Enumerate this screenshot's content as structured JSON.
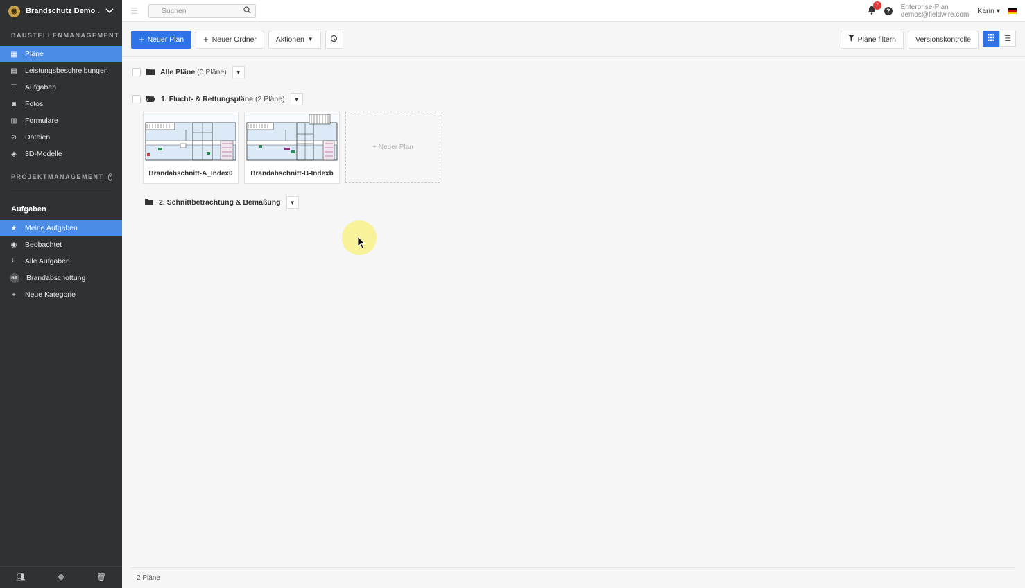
{
  "sidebar": {
    "project_name": "Brandschutz Demo ...",
    "section_baustelle": "BAUSTELLENMANAGEMENT",
    "nav_items": [
      {
        "label": "Pläne",
        "icon": "plans-icon",
        "active": true
      },
      {
        "label": "Leistungsbeschreibungen",
        "icon": "specs-icon"
      },
      {
        "label": "Aufgaben",
        "icon": "list-icon"
      },
      {
        "label": "Fotos",
        "icon": "camera-icon"
      },
      {
        "label": "Formulare",
        "icon": "clipboard-icon"
      },
      {
        "label": "Dateien",
        "icon": "paperclip-icon"
      },
      {
        "label": "3D-Modelle",
        "icon": "cube-icon"
      }
    ],
    "section_projekt": "PROJEKTMANAGEMENT",
    "tasks_group": "Aufgaben",
    "task_items": [
      {
        "label": "Meine Aufgaben",
        "icon": "star-icon",
        "active": true
      },
      {
        "label": "Beobachtet",
        "icon": "eye-icon"
      },
      {
        "label": "Alle Aufgaben",
        "icon": "grid-icon"
      },
      {
        "label": "Brandabschottung",
        "icon": "category-badge",
        "badge": "BR"
      },
      {
        "label": "Neue Kategorie",
        "icon": "plus-icon"
      }
    ]
  },
  "topbar": {
    "search_placeholder": "Suchen",
    "notification_count": "7",
    "plan_name": "Enterprise-Plan",
    "plan_email": "demos@fieldwire.com",
    "user": "Karin"
  },
  "toolbar": {
    "new_plan": "Neuer Plan",
    "new_folder": "Neuer Ordner",
    "actions": "Aktionen",
    "filter": "Pläne filtern",
    "version_control": "Versionskontrolle"
  },
  "folders": [
    {
      "name": "Alle Pläne",
      "count": "(0 Pläne)"
    },
    {
      "name": "1. Flucht- & Rettungspläne",
      "count": "(2 Pläne)"
    },
    {
      "name": "2. Schnittbetrachtung & Bemaßung",
      "count": ""
    }
  ],
  "plans": [
    {
      "name": "Brandabschnitt-A_Index0"
    },
    {
      "name": "Brandabschnitt-B-Indexb"
    }
  ],
  "new_plan_card": "+ Neuer Plan",
  "footer_count": "2 Pläne",
  "colors": {
    "accent": "#2f74e6",
    "sidebar_bg": "#2f3133",
    "sidebar_active": "#4b8ce6"
  }
}
